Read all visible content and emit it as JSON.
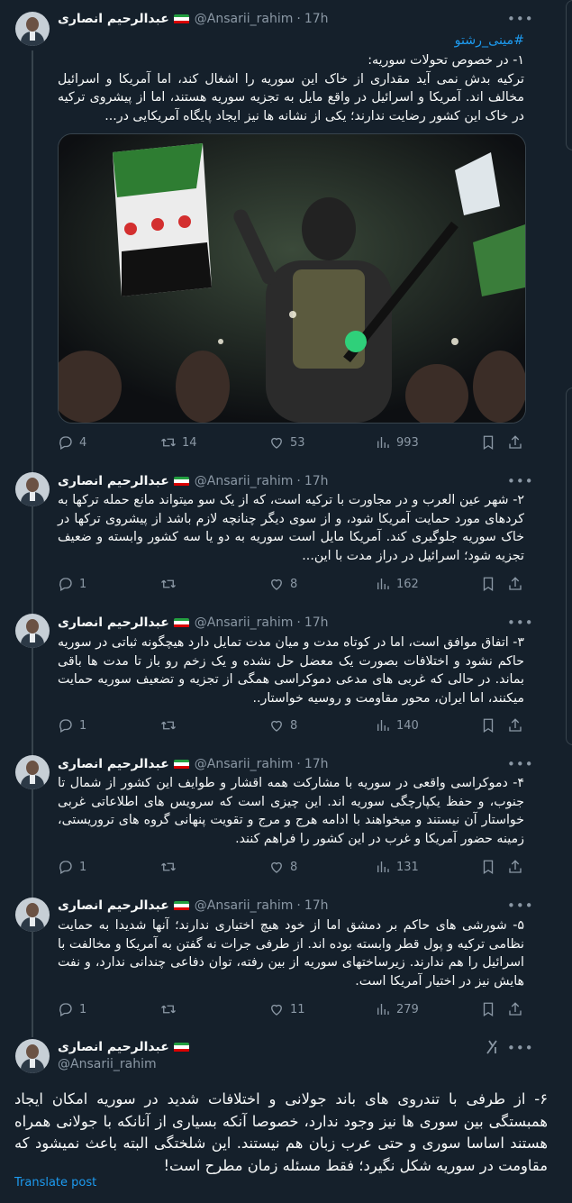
{
  "author": {
    "name": "عبدالرحیم انصاری",
    "handle": "@Ansarii_rahim"
  },
  "tweets": [
    {
      "time": "17h",
      "hashtag": "#مینی_رشتو",
      "text": "۱- در خصوص تحولات سوریه:\nترکیه بدش نمی آید مقداری از خاک این سوریه را اشغال کند، اما آمریکا و اسرائیل مخالف اند. آمریکا و اسرائیل در واقع مایل به تجزیه سوریه هستند، اما از پیشروی ترکیه در خاک این کشور رضایت ندارند؛ یکی از نشانه ها نیز ایجاد پایگاه آمریکایی در...",
      "replies": "4",
      "retweets": "14",
      "likes": "53",
      "views": "993"
    },
    {
      "time": "17h",
      "text": "۲- شهر عین العرب و در مجاورت با ترکیه است، که از یک سو میتواند مانع حمله ترکها به کردهای مورد حمایت آمریکا شود، و از سوی دیگر چنانچه لازم باشد از پیشروی ترکها در خاک سوریه جلوگیری کند. آمریکا مایل است سوریه به دو یا سه کشور وابسته و ضعیف تجزیه شود؛ اسرائیل در دراز مدت با این...",
      "replies": "1",
      "retweets": "",
      "likes": "8",
      "views": "162"
    },
    {
      "time": "17h",
      "text": "۳- اتفاق موافق است، اما در کوتاه مدت و میان مدت تمایل دارد هیچگونه ثباتی در سوریه حاکم نشود و اختلافات بصورت یک معضل حل نشده و یک زخم رو باز تا مدت ها باقی بماند. در حالی که غربی های مدعی دموکراسی همگی از تجزیه و تضعیف سوریه حمایت میکنند، اما ایران، محور مقاومت و روسیه خواستار..",
      "replies": "1",
      "retweets": "",
      "likes": "8",
      "views": "140"
    },
    {
      "time": "17h",
      "text": "۴- دموکراسی واقعی در سوریه با مشارکت همه اقشار و طوایف این کشور از شمال تا جنوب، و حفظ یکپارچگی سوریه اند. این چیزی است که سرویس های اطلاعاتی غربی خواستار آن نیستند و میخواهند با ادامه هرج و مرج و تقویت پنهانی گروه های تروریستی، زمینه حضور آمریکا و غرب در این کشور را فراهم کنند.",
      "replies": "1",
      "retweets": "",
      "likes": "8",
      "views": "131"
    },
    {
      "time": "17h",
      "text": "۵- شورشی های حاکم بر دمشق اما از خود هیچ اختیاری ندارند؛ آنها شدیدا به حمایت نظامی ترکیه و پول قطر وابسته بوده اند. از طرفی جرات نه گفتن به آمریکا و مخالفت با اسرائیل را هم ندارند. زیرساختهای سوریه از بین رفته، توان دفاعی چندانی ندارد، و نفت هایش نیز در اختیار آمریکا است.",
      "replies": "1",
      "retweets": "",
      "likes": "11",
      "views": "279"
    }
  ],
  "main_tweet": {
    "text": "۶- از طرفی با تندروی های باند جولانی و اختلافات شدید در سوریه امکان ایجاد همبستگی بین سوری ها نیز وجود ندارد، خصوصا آنکه بسیاری از آنانکه با جولانی همراه هستند اساسا سوری و حتی عرب زبان هم نیستند. این شلختگی البته باعث نمیشود که مقاومت در سوریه شکل نگیرد؛ فقط مسئله زمان مطرح است!",
    "translate_label": "Translate post"
  },
  "icons": {
    "reply": "reply-icon",
    "retweet": "retweet-icon",
    "like": "heart-icon",
    "views": "views-icon",
    "bookmark": "bookmark-icon",
    "share": "share-icon",
    "more": "more-icon",
    "grok": "grok-icon"
  },
  "colors": {
    "background": "#15202b",
    "accent": "#1d9bf0",
    "muted": "#8b98a5"
  }
}
